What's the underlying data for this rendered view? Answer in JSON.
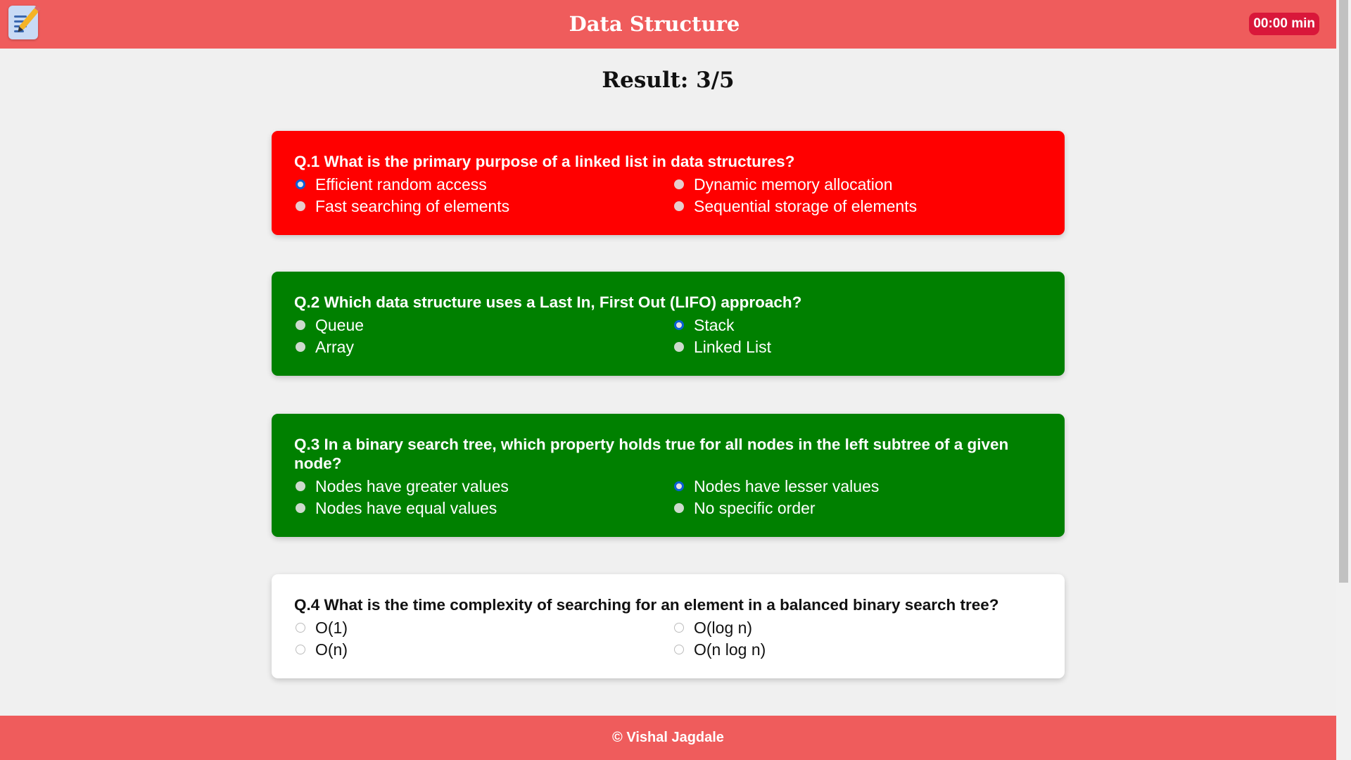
{
  "header": {
    "title": "Data Structure",
    "timer": "00:00 min",
    "menu_icon": "notes-pencil-icon"
  },
  "result": {
    "label": "Result: 3/5"
  },
  "questions": [
    {
      "text": "Q.1 What is the primary purpose of a linked list in data structures?",
      "status": "wrong",
      "options": [
        "Efficient random access",
        "Dynamic memory allocation",
        "Fast searching of elements",
        "Sequential storage of elements"
      ],
      "selected": 0
    },
    {
      "text": "Q.2 Which data structure uses a Last In, First Out (LIFO) approach?",
      "status": "right",
      "options": [
        "Queue",
        "Stack",
        "Array",
        "Linked List"
      ],
      "selected": 1
    },
    {
      "text": "Q.3 In a binary search tree, which property holds true for all nodes in the left subtree of a given node?",
      "status": "right",
      "options": [
        "Nodes have greater values",
        "Nodes have lesser values",
        "Nodes have equal values",
        "No specific order"
      ],
      "selected": 1
    },
    {
      "text": "Q.4 What is the time complexity of searching for an element in a balanced binary search tree?",
      "status": "pending",
      "options": [
        "O(1)",
        "O(log n)",
        "O(n)",
        "O(n log n)"
      ],
      "selected": null
    }
  ],
  "footer": {
    "text": "© Vishal Jagdale"
  },
  "colors": {
    "header_bg": "#ef5c5c",
    "wrong_bg": "#ff0000",
    "right_bg": "#008000",
    "pending_bg": "#ffffff",
    "timer_bg": "#d9173a"
  }
}
